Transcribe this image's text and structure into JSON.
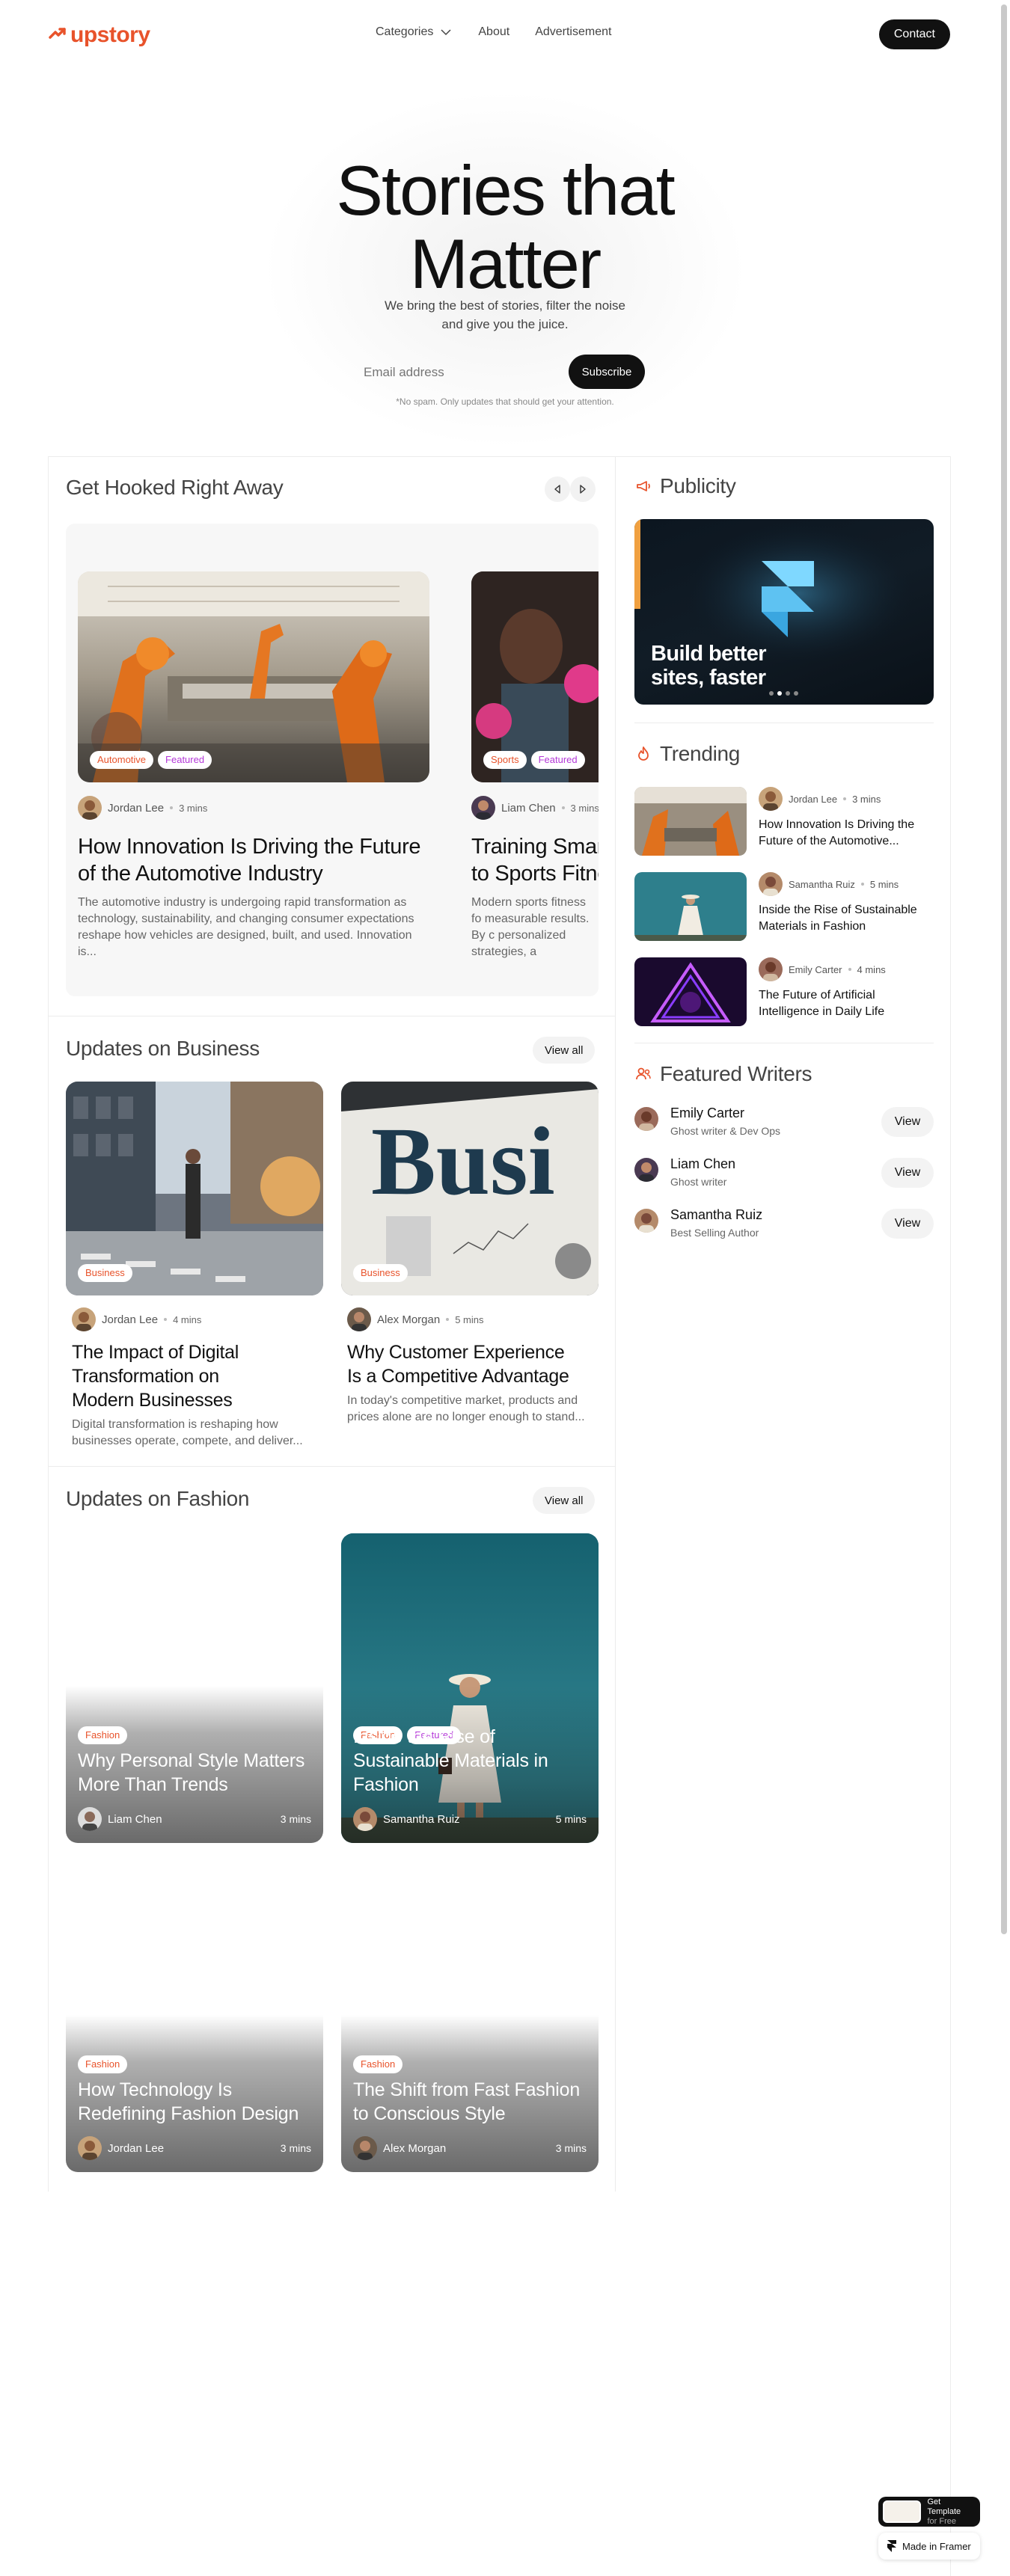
{
  "nav": {
    "logo_text": "upstory",
    "links": [
      "Categories",
      "About",
      "Advertisement"
    ],
    "contact_label": "Contact"
  },
  "hero": {
    "title_line1": "Stories that",
    "title_line2": "Matter",
    "subtitle": "We bring the best of stories, filter the noise and give you the juice.",
    "email_placeholder": "Email address",
    "subscribe_label": "Subscribe",
    "note": "*No spam. Only updates that should get your attention."
  },
  "hooked": {
    "title": "Get Hooked Right Away",
    "cards": [
      {
        "tags": [
          "Automotive",
          "Featured"
        ],
        "author": "Jordan Lee",
        "mins": "3 mins",
        "title": "How Innovation Is Driving the Future of the Automotive Industry",
        "excerpt": "The automotive industry is undergoing rapid transformation as technology, sustainability, and changing consumer expectations reshape how vehicles are designed, built, and used. Innovation is..."
      },
      {
        "tags": [
          "Sports",
          "Featured"
        ],
        "author": "Liam Chen",
        "mins": "3 mins",
        "title": "Training Smart to Sports Fitne",
        "excerpt": "Modern sports fitness fo measurable results. By c personalized strategies, a"
      }
    ]
  },
  "business": {
    "title": "Updates on Business",
    "view_all": "View all",
    "cards": [
      {
        "tag": "Business",
        "author": "Jordan Lee",
        "mins": "4 mins",
        "title": "The Impact of Digital Transformation on Modern Businesses",
        "excerpt": "Digital transformation is reshaping how businesses operate, compete, and deliver..."
      },
      {
        "tag": "Business",
        "author": "Alex Morgan",
        "mins": "5 mins",
        "title": "Why Customer Experience Is a Competitive Advantage",
        "excerpt": "In today's competitive market, products and prices alone are no longer enough to stand..."
      }
    ]
  },
  "fashion": {
    "title": "Updates on Fashion",
    "view_all": "View all",
    "cards": [
      {
        "tags": [
          "Fashion"
        ],
        "title": "Why Personal Style Matters More Than Trends",
        "author": "Liam Chen",
        "mins": "3 mins"
      },
      {
        "tags": [
          "Fashion",
          "Featured"
        ],
        "title": "Inside the Rise of Sustainable Materials in Fashion",
        "author": "Samantha Ruiz",
        "mins": "5 mins"
      },
      {
        "tags": [
          "Fashion"
        ],
        "title": "How Technology Is Redefining Fashion Design",
        "author": "Jordan Lee",
        "mins": "3 mins"
      },
      {
        "tags": [
          "Fashion"
        ],
        "title": "The Shift from Fast Fashion to Conscious Style",
        "author": "Alex Morgan",
        "mins": "3 mins"
      }
    ]
  },
  "publicity": {
    "title": "Publicity",
    "promo_line1": "Build better",
    "promo_line2": "sites, faster"
  },
  "trending": {
    "title": "Trending",
    "items": [
      {
        "author": "Jordan Lee",
        "mins": "3 mins",
        "title": "How Innovation Is Driving the Future of the Automotive..."
      },
      {
        "author": "Samantha Ruiz",
        "mins": "5 mins",
        "title": "Inside the Rise of Sustainable Materials in Fashion"
      },
      {
        "author": "Emily Carter",
        "mins": "4 mins",
        "title": "The Future of Artificial Intelligence in Daily Life"
      }
    ]
  },
  "writers": {
    "title": "Featured Writers",
    "view_label": "View",
    "items": [
      {
        "name": "Emily Carter",
        "role": "Ghost writer & Dev Ops"
      },
      {
        "name": "Liam Chen",
        "role": "Ghost writer"
      },
      {
        "name": "Samantha Ruiz",
        "role": "Best Selling Author"
      }
    ]
  },
  "framer": {
    "get_template": "Get Template",
    "for_free": "for Free",
    "made_in": "Made in Framer"
  },
  "colors": {
    "brand": "#e8532b",
    "tag_featured": "#b438d8",
    "dark": "#111111"
  }
}
